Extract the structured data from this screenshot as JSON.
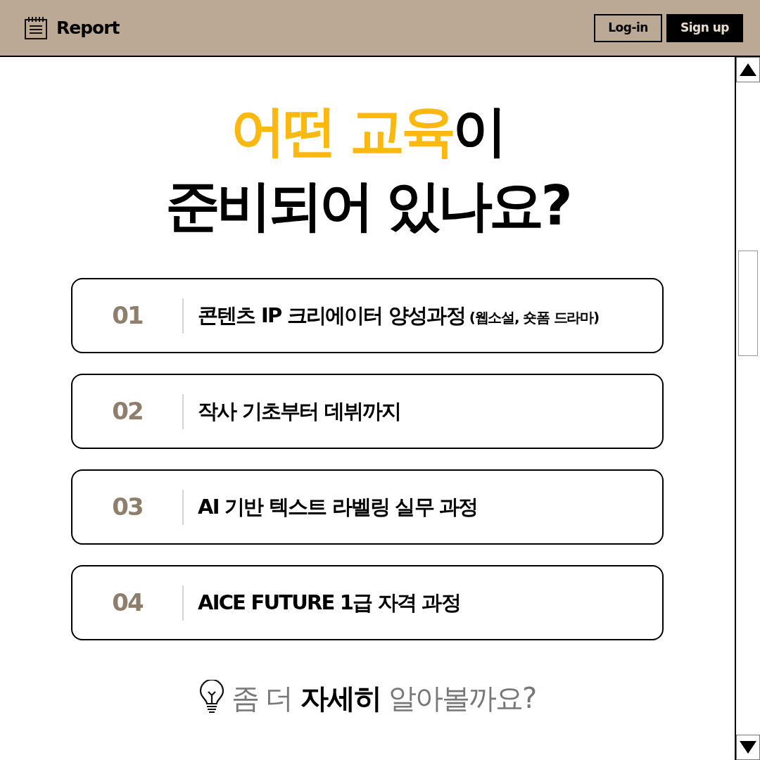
{
  "header": {
    "brand": "Report",
    "buttons": [
      {
        "label": "Log-in",
        "kind": "outline"
      },
      {
        "label": "Sign up",
        "kind": "solid"
      }
    ]
  },
  "headline": [
    [
      {
        "text": "어떤 교육",
        "accent": true
      },
      {
        "text": "이",
        "accent": false
      }
    ],
    [
      {
        "text": "준비되어 있나요?",
        "accent": false
      }
    ]
  ],
  "courses": [
    {
      "number": "01",
      "title": "콘텐츠 IP 크리에이터 양성과정",
      "note": "(웹소설, 숏폼 드라마)"
    },
    {
      "number": "02",
      "title": "작사 기초부터 데뷔까지"
    },
    {
      "number": "03",
      "title": "AI 기반 텍스트 라벨링 실무 과정"
    },
    {
      "number": "04",
      "title": "AICE FUTURE 1급 자격 과정"
    }
  ],
  "more": [
    {
      "text": "좀 더",
      "emphasis": false
    },
    {
      "text": "자세히",
      "emphasis": true
    },
    {
      "text": "알아볼까요?",
      "emphasis": false
    }
  ]
}
